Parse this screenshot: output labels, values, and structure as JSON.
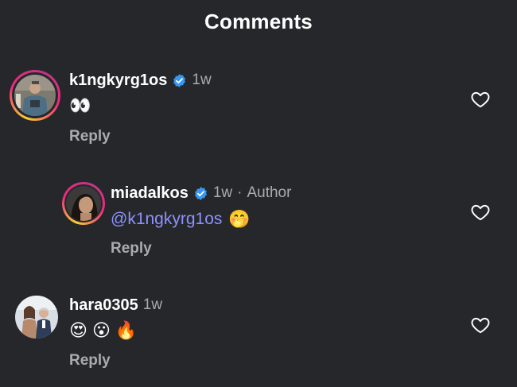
{
  "header": {
    "title": "Comments"
  },
  "comments": [
    {
      "username": "k1ngkyrg1os",
      "verified": true,
      "time": "1w",
      "author_tag": "",
      "text": "👀",
      "reply_label": "Reply"
    },
    {
      "username": "miadalkos",
      "verified": true,
      "time": "1w",
      "separator": "·",
      "author_tag": "Author",
      "mention": "@k1ngkyrg1os",
      "text": "🤭",
      "reply_label": "Reply"
    },
    {
      "username": "hara0305",
      "verified": false,
      "time": "1w",
      "author_tag": "",
      "emojis": [
        "😍",
        "😮",
        "🔥"
      ],
      "reply_label": "Reply"
    }
  ],
  "icons": {
    "verified": "verified-badge-icon",
    "like": "heart-outline-icon"
  },
  "colors": {
    "background": "#25272b",
    "secondary_text": "#a8abb0",
    "mention": "#8d92ff",
    "verified_blue": "#3897f0"
  }
}
